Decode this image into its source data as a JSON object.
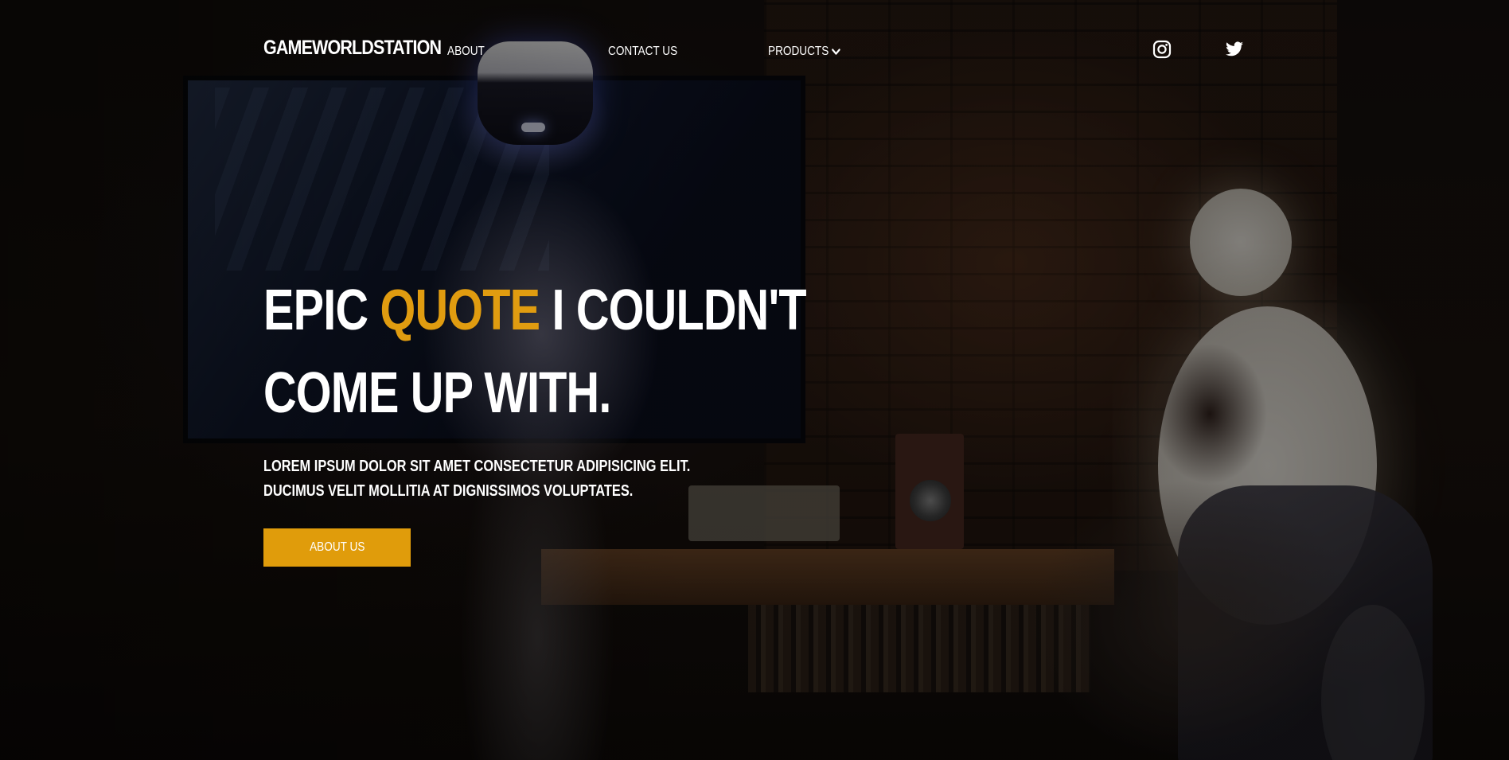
{
  "header": {
    "logo": "GAMEWORLDSTATION",
    "nav": {
      "about": "ABOUT",
      "contact": "CONTACT US",
      "products": "PRODUCTS"
    },
    "social_icons": [
      "instagram-icon",
      "twitter-icon"
    ]
  },
  "hero": {
    "title_part1": "EPIC ",
    "title_accent": "QUOTE",
    "title_part2": " I COULDN'T",
    "title_line2": "COME UP WITH.",
    "text": "LOREM IPSUM DOLOR SIT AMET CONSECTETUR ADIPISICING ELIT. DUCIMUS VELIT MOLLITIA AT DIGNISSIMOS VOLUPTATES.",
    "cta_label": "ABOUT US"
  },
  "colors": {
    "accent": "#e09c0b",
    "text": "#ffffff",
    "background": "#0b0908"
  }
}
